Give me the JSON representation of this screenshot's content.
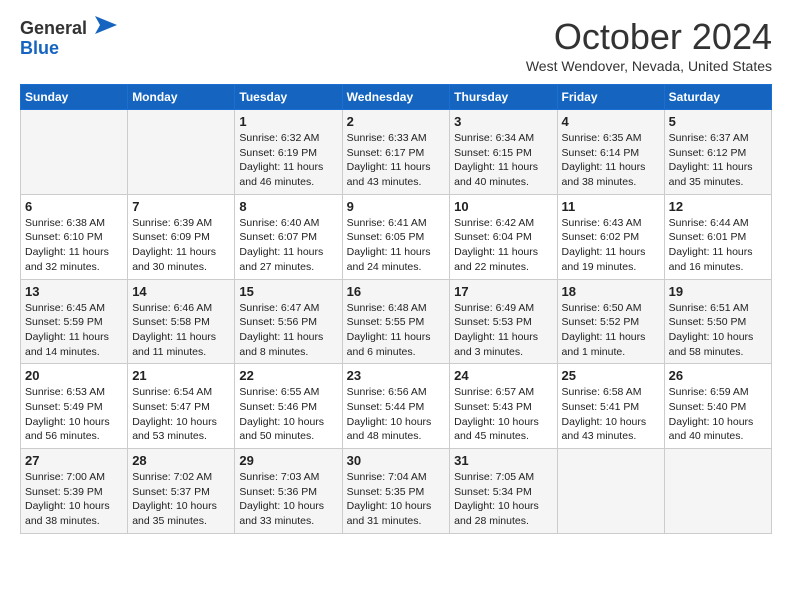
{
  "header": {
    "logo_general": "General",
    "logo_blue": "Blue",
    "month_title": "October 2024",
    "location": "West Wendover, Nevada, United States"
  },
  "days_of_week": [
    "Sunday",
    "Monday",
    "Tuesday",
    "Wednesday",
    "Thursday",
    "Friday",
    "Saturday"
  ],
  "weeks": [
    [
      {
        "day": "",
        "info": ""
      },
      {
        "day": "",
        "info": ""
      },
      {
        "day": "1",
        "info": "Sunrise: 6:32 AM\nSunset: 6:19 PM\nDaylight: 11 hours and 46 minutes."
      },
      {
        "day": "2",
        "info": "Sunrise: 6:33 AM\nSunset: 6:17 PM\nDaylight: 11 hours and 43 minutes."
      },
      {
        "day": "3",
        "info": "Sunrise: 6:34 AM\nSunset: 6:15 PM\nDaylight: 11 hours and 40 minutes."
      },
      {
        "day": "4",
        "info": "Sunrise: 6:35 AM\nSunset: 6:14 PM\nDaylight: 11 hours and 38 minutes."
      },
      {
        "day": "5",
        "info": "Sunrise: 6:37 AM\nSunset: 6:12 PM\nDaylight: 11 hours and 35 minutes."
      }
    ],
    [
      {
        "day": "6",
        "info": "Sunrise: 6:38 AM\nSunset: 6:10 PM\nDaylight: 11 hours and 32 minutes."
      },
      {
        "day": "7",
        "info": "Sunrise: 6:39 AM\nSunset: 6:09 PM\nDaylight: 11 hours and 30 minutes."
      },
      {
        "day": "8",
        "info": "Sunrise: 6:40 AM\nSunset: 6:07 PM\nDaylight: 11 hours and 27 minutes."
      },
      {
        "day": "9",
        "info": "Sunrise: 6:41 AM\nSunset: 6:05 PM\nDaylight: 11 hours and 24 minutes."
      },
      {
        "day": "10",
        "info": "Sunrise: 6:42 AM\nSunset: 6:04 PM\nDaylight: 11 hours and 22 minutes."
      },
      {
        "day": "11",
        "info": "Sunrise: 6:43 AM\nSunset: 6:02 PM\nDaylight: 11 hours and 19 minutes."
      },
      {
        "day": "12",
        "info": "Sunrise: 6:44 AM\nSunset: 6:01 PM\nDaylight: 11 hours and 16 minutes."
      }
    ],
    [
      {
        "day": "13",
        "info": "Sunrise: 6:45 AM\nSunset: 5:59 PM\nDaylight: 11 hours and 14 minutes."
      },
      {
        "day": "14",
        "info": "Sunrise: 6:46 AM\nSunset: 5:58 PM\nDaylight: 11 hours and 11 minutes."
      },
      {
        "day": "15",
        "info": "Sunrise: 6:47 AM\nSunset: 5:56 PM\nDaylight: 11 hours and 8 minutes."
      },
      {
        "day": "16",
        "info": "Sunrise: 6:48 AM\nSunset: 5:55 PM\nDaylight: 11 hours and 6 minutes."
      },
      {
        "day": "17",
        "info": "Sunrise: 6:49 AM\nSunset: 5:53 PM\nDaylight: 11 hours and 3 minutes."
      },
      {
        "day": "18",
        "info": "Sunrise: 6:50 AM\nSunset: 5:52 PM\nDaylight: 11 hours and 1 minute."
      },
      {
        "day": "19",
        "info": "Sunrise: 6:51 AM\nSunset: 5:50 PM\nDaylight: 10 hours and 58 minutes."
      }
    ],
    [
      {
        "day": "20",
        "info": "Sunrise: 6:53 AM\nSunset: 5:49 PM\nDaylight: 10 hours and 56 minutes."
      },
      {
        "day": "21",
        "info": "Sunrise: 6:54 AM\nSunset: 5:47 PM\nDaylight: 10 hours and 53 minutes."
      },
      {
        "day": "22",
        "info": "Sunrise: 6:55 AM\nSunset: 5:46 PM\nDaylight: 10 hours and 50 minutes."
      },
      {
        "day": "23",
        "info": "Sunrise: 6:56 AM\nSunset: 5:44 PM\nDaylight: 10 hours and 48 minutes."
      },
      {
        "day": "24",
        "info": "Sunrise: 6:57 AM\nSunset: 5:43 PM\nDaylight: 10 hours and 45 minutes."
      },
      {
        "day": "25",
        "info": "Sunrise: 6:58 AM\nSunset: 5:41 PM\nDaylight: 10 hours and 43 minutes."
      },
      {
        "day": "26",
        "info": "Sunrise: 6:59 AM\nSunset: 5:40 PM\nDaylight: 10 hours and 40 minutes."
      }
    ],
    [
      {
        "day": "27",
        "info": "Sunrise: 7:00 AM\nSunset: 5:39 PM\nDaylight: 10 hours and 38 minutes."
      },
      {
        "day": "28",
        "info": "Sunrise: 7:02 AM\nSunset: 5:37 PM\nDaylight: 10 hours and 35 minutes."
      },
      {
        "day": "29",
        "info": "Sunrise: 7:03 AM\nSunset: 5:36 PM\nDaylight: 10 hours and 33 minutes."
      },
      {
        "day": "30",
        "info": "Sunrise: 7:04 AM\nSunset: 5:35 PM\nDaylight: 10 hours and 31 minutes."
      },
      {
        "day": "31",
        "info": "Sunrise: 7:05 AM\nSunset: 5:34 PM\nDaylight: 10 hours and 28 minutes."
      },
      {
        "day": "",
        "info": ""
      },
      {
        "day": "",
        "info": ""
      }
    ]
  ]
}
